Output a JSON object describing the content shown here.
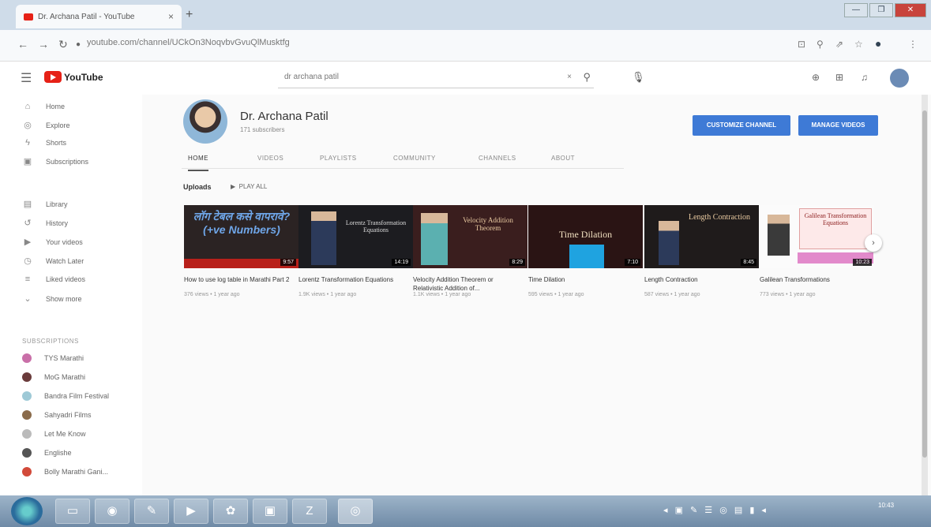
{
  "browser": {
    "tab_title": "Dr. Archana Patil - YouTube",
    "tab_close": "×",
    "new_tab": "+",
    "url": "youtube.com/channel/UCkOn3NoqvbvGvuQlMusktfg",
    "window_buttons": [
      "—",
      "❐",
      "✕"
    ]
  },
  "youtube": {
    "logo_text": "YouTube",
    "search_value": "dr archana patil",
    "search_clear": "×"
  },
  "sidebar": {
    "main_items": [
      {
        "label": "Home",
        "icon": "home-icon"
      },
      {
        "label": "Explore",
        "icon": "explore-icon"
      },
      {
        "label": "Shorts",
        "icon": "shorts-icon"
      },
      {
        "label": "Subscriptions",
        "icon": "subscriptions-icon"
      }
    ],
    "library_items": [
      {
        "label": "Library",
        "icon": "library-icon"
      },
      {
        "label": "History",
        "icon": "history-icon"
      },
      {
        "label": "Your videos",
        "icon": "your-videos-icon"
      },
      {
        "label": "Watch Later",
        "icon": "watch-later-icon"
      },
      {
        "label": "Liked videos",
        "icon": "liked-icon"
      },
      {
        "label": "Show more",
        "icon": "chevron-down-icon"
      }
    ],
    "subscriptions_header": "SUBSCRIPTIONS",
    "subscriptions": [
      {
        "label": "TYS Marathi",
        "color": "#c96fa8"
      },
      {
        "label": "MoG Marathi",
        "color": "#6a3b3b"
      },
      {
        "label": "Bandra Film Festival",
        "color": "#9ec9d6"
      },
      {
        "label": "Sahyadri Films",
        "color": "#8a6b4b"
      },
      {
        "label": "Let Me Know",
        "color": "#bbbbbb"
      },
      {
        "label": "Englishe",
        "color": "#555555"
      },
      {
        "label": "Bolly Marathi Gani...",
        "color": "#d24a3a"
      }
    ]
  },
  "channel": {
    "name": "Dr. Archana Patil",
    "subscribers": "171 subscribers",
    "customize_button": "CUSTOMIZE CHANNEL",
    "manage_button": "MANAGE VIDEOS",
    "tabs": [
      "HOME",
      "VIDEOS",
      "PLAYLISTS",
      "COMMUNITY",
      "CHANNELS",
      "ABOUT"
    ],
    "uploads_label": "Uploads",
    "play_all_label": "PLAY ALL"
  },
  "videos": [
    {
      "title": "How to use log table in Marathi Part 2",
      "meta": "376 views • 1 year ago",
      "duration": "9:57",
      "thumb_text": "लॉग टेबल कसे वापरावे? (+ve Numbers)"
    },
    {
      "title": "Lorentz Transformation Equations",
      "meta": "1.9K views • 1 year ago",
      "duration": "14:19",
      "thumb_text": "Lorentz Transformation Equations"
    },
    {
      "title": "Velocity Addition Theorem or Relativistic Addition of...",
      "meta": "1.1K views • 1 year ago",
      "duration": "8:29",
      "thumb_text": "Velocity Addition Theorem"
    },
    {
      "title": "Time Dilation",
      "meta": "595 views • 1 year ago",
      "duration": "7:10",
      "thumb_text": "Time Dilation"
    },
    {
      "title": "Length Contraction",
      "meta": "587 views • 1 year ago",
      "duration": "8:45",
      "thumb_text": "Length Contraction"
    },
    {
      "title": "Galilean Transformations",
      "meta": "773 views • 1 year ago",
      "duration": "10:23",
      "thumb_text": "Galilean Transformation Equations"
    }
  ],
  "taskbar": {
    "clock": "10:43"
  }
}
